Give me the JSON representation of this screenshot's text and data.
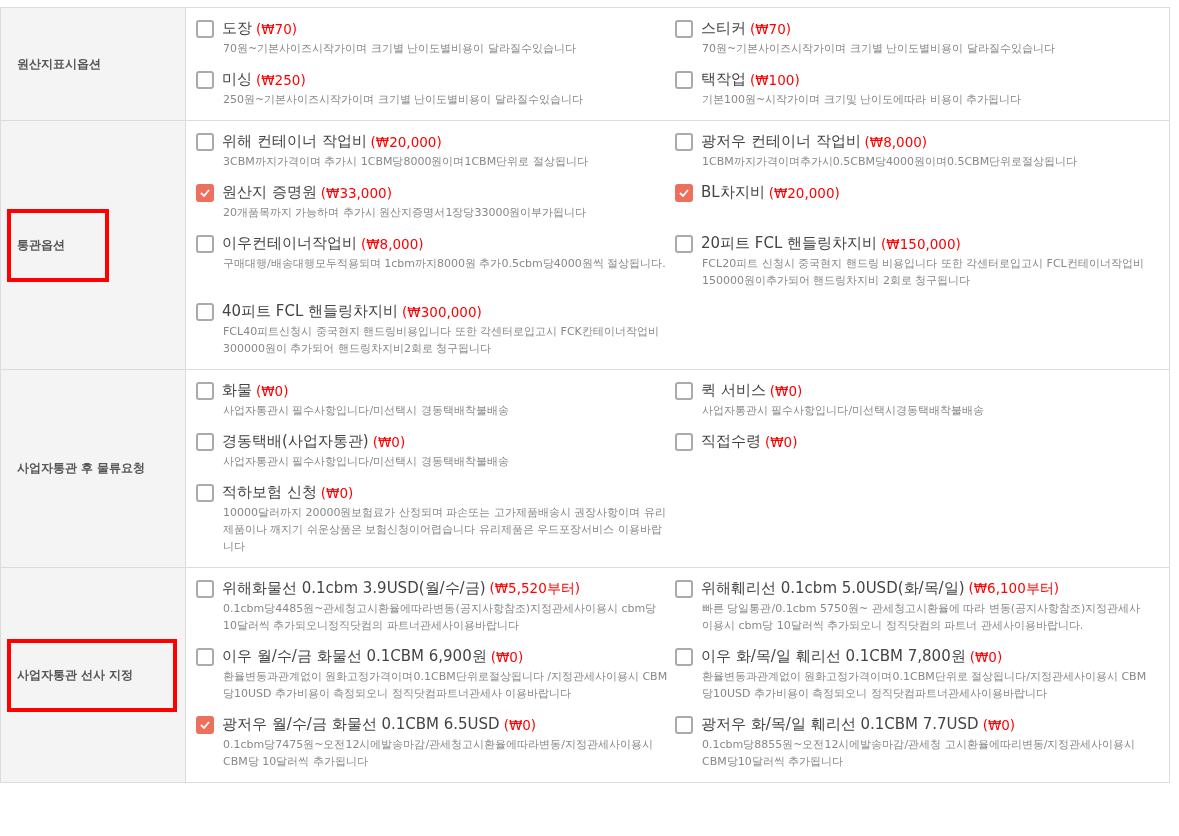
{
  "sections": [
    {
      "label": "원산지표시옵션",
      "highlighted": false,
      "options": [
        {
          "name": "도장",
          "price": "(₩70)",
          "checked": false,
          "description": "70원~기본사이즈시작가이며 크기별 난이도별비용이 달라질수있습니다"
        },
        {
          "name": "스티커",
          "price": "(₩70)",
          "checked": false,
          "description": "70원~기본사이즈시작가이며 크기별 난이도별비용이 달라질수있습니다"
        },
        {
          "name": "미싱",
          "price": "(₩250)",
          "checked": false,
          "description": "250원~기본사이즈시작가이며 크기별 난이도별비용이 달라질수있습니다"
        },
        {
          "name": "택작업",
          "price": "(₩100)",
          "checked": false,
          "description": "기본100원~시작가이며 크기및 난이도에따라 비용이 추가됩니다"
        }
      ]
    },
    {
      "label": "통관옵션",
      "highlighted": true,
      "options": [
        {
          "name": "위해 컨테이너 작업비",
          "price": "(₩20,000)",
          "checked": false,
          "description": "3CBM까지가격이며 추가시 1CBM당8000원이며1CBM단위로 절상됩니다"
        },
        {
          "name": "광저우 컨테이너 작업비",
          "price": "(₩8,000)",
          "checked": false,
          "description": "1CBM까지가격이며추가시0.5CBM당4000원이며0.5CBM단위로절상됩니다"
        },
        {
          "name": "원산지 증명원",
          "price": "(₩33,000)",
          "checked": true,
          "description": "20개품목까지 가능하며 추가시 원산지증명서1장당33000원이부가됩니다"
        },
        {
          "name": "BL차지비",
          "price": "(₩20,000)",
          "checked": true
        },
        {
          "name": "이우컨테이너작업비",
          "price": "(₩8,000)",
          "checked": false,
          "description": "구매대행/배송대행모두적용되며 1cbm까지8000원 추가0.5cbm당4000원씩 절상됩니다."
        },
        {
          "name": "20피트 FCL 핸들링차지비",
          "price": "(₩150,000)",
          "checked": false,
          "description": "FCL20피트 신청시 중국현지 핸드링 비용입니다 또한 각센터로입고시 FCL컨테이너작업비150000원이추가되어 핸드링차지비 2회로 청구됩니다"
        },
        {
          "name": "40피트 FCL 핸들링차지비",
          "price": "(₩300,000)",
          "checked": false,
          "description": "FCL40피트신청시 중국현지 핸드링비용입니다 또한 각센터로입고시 FCK칸테이너작업비 300000원이 추가되어 핸드링차지비2회로 청구됩니다"
        }
      ]
    },
    {
      "label": "사업자통관 후 물류요청",
      "highlighted": false,
      "options": [
        {
          "name": "화물",
          "price": "(₩0)",
          "checked": false,
          "description": "사업자통관시 필수사항입니다/미선택시 경동택배착불배송"
        },
        {
          "name": "퀵 서비스",
          "price": "(₩0)",
          "checked": false,
          "description": "사업자통관시 필수사항입니다/미선택시경동택배착불배송"
        },
        {
          "name": "경동택배(사업자통관)",
          "price": "(₩0)",
          "checked": false,
          "description": "사업자통관시 필수사항입니다/미선택시 경동택배착불배송"
        },
        {
          "name": "직접수령",
          "price": "(₩0)",
          "checked": false
        },
        {
          "name": "적하보험 신청",
          "price": "(₩0)",
          "checked": false,
          "description": "10000달러까지 20000원보험료가 산정되며 파손또는 고가제품배송시 권장사항이며 유리제품이나 깨지기 쉬운상품은 보험신청이어렵습니다 유리제품은 우드포장서비스 이용바랍니다"
        }
      ]
    },
    {
      "label": "사업자통관 선사 지정",
      "highlighted": true,
      "options": [
        {
          "name": "위해화물선 0.1cbm 3.9USD(월/수/금)",
          "price": "(₩5,520부터)",
          "checked": false,
          "description": "0.1cbm당4485원~관세청고시환율에따라변동(공지사항참조)지정관세사이용시 cbm당10달러씩 추가되오니정직닷컴의 파트너관세사이용바랍니다"
        },
        {
          "name": "위해훼리선 0.1cbm 5.0USD(화/목/일)",
          "price": "(₩6,100부터)",
          "checked": false,
          "description": "빠른 당일통관/0.1cbm 5750원~ 관세청고시환율에 따라 변동(공지사항참조)지정관세사이용시 cbm당 10달러씩 추가되오니 정직닷컴의 파트너 관세사이용바랍니다."
        },
        {
          "name": "이우 월/수/금 화물선 0.1CBM 6,900원",
          "price": "(₩0)",
          "checked": false,
          "description": "환율변동과관계없이 원화고정가격이며0.1CBM단위로절상됩니다 /지정관세사이용시 CBM당10USD 추가비용이 측정되오니 정직닷컴파트너관세사 이용바랍니다"
        },
        {
          "name": "이우 화/목/일 훼리선 0.1CBM 7,800원",
          "price": "(₩0)",
          "checked": false,
          "description": "환율변동과관계없이 원화고정가격이며0.1CBM단위로 절상됩니다/지정관세사이용시 CBM당10USD 추가비용이 측정되오니 정직닷컴파트너관세사이용바랍니다"
        },
        {
          "name": "광저우 월/수/금 화물선 0.1CBM 6.5USD",
          "price": "(₩0)",
          "checked": true,
          "description": "0.1cbm당7475원~오전12시에발송마감/관세청고시환율에따라변동/지정관세사이용시CBM당 10달러씩 추가됩니다"
        },
        {
          "name": "광저우 화/목/일 훼리선 0.1CBM 7.7USD",
          "price": "(₩0)",
          "checked": false,
          "description": "0.1cbm당8855원~오전12시에발송마감/관세청 고시환율에따리변동/지정관세사이용시CBM당10달러씩 추가됩니다"
        }
      ]
    }
  ]
}
